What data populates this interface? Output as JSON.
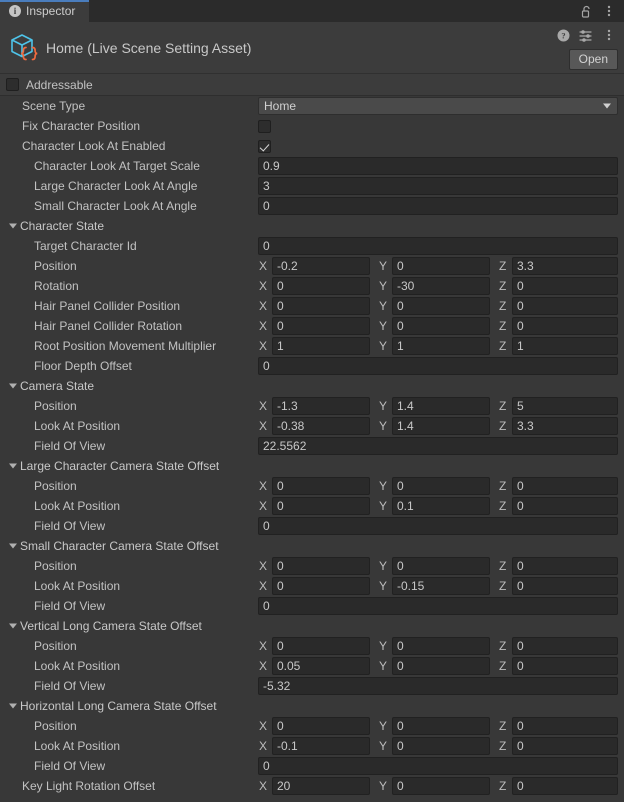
{
  "window": {
    "tab_label": "Inspector",
    "tab_icon": "info-icon",
    "lock_icon": "lock-open-icon",
    "tab_menu_icon": "kebab-menu-icon"
  },
  "asset": {
    "title": "Home (Live Scene Setting Asset)",
    "icon": "scriptable-object-cube-icon",
    "help_icon": "help-icon",
    "preset_icon": "preset-sliders-icon",
    "menu_icon": "kebab-menu-icon",
    "open_label": "Open"
  },
  "addressable": {
    "label": "Addressable",
    "checked": false
  },
  "accent": {
    "tab_underline": "#4a7dbd",
    "icon_cube": "#4ec3e8",
    "icon_braces": "#f06b3f"
  },
  "axes": {
    "x": "X",
    "y": "Y",
    "z": "Z"
  },
  "rows": [
    {
      "type": "dropdown",
      "indent": 0,
      "label": "Scene Type",
      "value": "Home"
    },
    {
      "type": "checkbox",
      "indent": 0,
      "label": "Fix Character Position",
      "checked": false
    },
    {
      "type": "checkbox",
      "indent": 0,
      "label": "Character Look At Enabled",
      "checked": true
    },
    {
      "type": "text",
      "indent": 1,
      "label": "Character Look At Target Scale",
      "value": "0.9"
    },
    {
      "type": "text",
      "indent": 1,
      "label": "Large Character Look At Angle",
      "value": "3"
    },
    {
      "type": "text",
      "indent": 1,
      "label": "Small Character Look At Angle",
      "value": "0"
    },
    {
      "type": "foldout",
      "indent": 0,
      "label": "Character State",
      "expanded": true
    },
    {
      "type": "text",
      "indent": 1,
      "label": "Target Character Id",
      "value": "0"
    },
    {
      "type": "vector3",
      "indent": 1,
      "label": "Position",
      "x": "-0.2",
      "y": "0",
      "z": "3.3"
    },
    {
      "type": "vector3",
      "indent": 1,
      "label": "Rotation",
      "x": "0",
      "y": "-30",
      "z": "0"
    },
    {
      "type": "vector3",
      "indent": 1,
      "label": "Hair Panel Collider Position",
      "x": "0",
      "y": "0",
      "z": "0"
    },
    {
      "type": "vector3",
      "indent": 1,
      "label": "Hair Panel Collider Rotation",
      "x": "0",
      "y": "0",
      "z": "0"
    },
    {
      "type": "vector3",
      "indent": 1,
      "label": "Root Position Movement Multiplier",
      "x": "1",
      "y": "1",
      "z": "1"
    },
    {
      "type": "text",
      "indent": 1,
      "label": "Floor Depth Offset",
      "value": "0"
    },
    {
      "type": "foldout",
      "indent": 0,
      "label": "Camera State",
      "expanded": true
    },
    {
      "type": "vector3",
      "indent": 1,
      "label": "Position",
      "x": "-1.3",
      "y": "1.4",
      "z": "5"
    },
    {
      "type": "vector3",
      "indent": 1,
      "label": "Look At Position",
      "x": "-0.38",
      "y": "1.4",
      "z": "3.3"
    },
    {
      "type": "text",
      "indent": 1,
      "label": "Field Of View",
      "value": "22.5562"
    },
    {
      "type": "foldout",
      "indent": 0,
      "label": "Large Character Camera State Offset",
      "expanded": true
    },
    {
      "type": "vector3",
      "indent": 1,
      "label": "Position",
      "x": "0",
      "y": "0",
      "z": "0"
    },
    {
      "type": "vector3",
      "indent": 1,
      "label": "Look At Position",
      "x": "0",
      "y": "0.1",
      "z": "0"
    },
    {
      "type": "text",
      "indent": 1,
      "label": "Field Of View",
      "value": "0"
    },
    {
      "type": "foldout",
      "indent": 0,
      "label": "Small Character Camera State Offset",
      "expanded": true
    },
    {
      "type": "vector3",
      "indent": 1,
      "label": "Position",
      "x": "0",
      "y": "0",
      "z": "0"
    },
    {
      "type": "vector3",
      "indent": 1,
      "label": "Look At Position",
      "x": "0",
      "y": "-0.15",
      "z": "0"
    },
    {
      "type": "text",
      "indent": 1,
      "label": "Field Of View",
      "value": "0"
    },
    {
      "type": "foldout",
      "indent": 0,
      "label": "Vertical Long Camera State Offset",
      "expanded": true
    },
    {
      "type": "vector3",
      "indent": 1,
      "label": "Position",
      "x": "0",
      "y": "0",
      "z": "0"
    },
    {
      "type": "vector3",
      "indent": 1,
      "label": "Look At Position",
      "x": "0.05",
      "y": "0",
      "z": "0"
    },
    {
      "type": "text",
      "indent": 1,
      "label": "Field Of View",
      "value": "-5.32"
    },
    {
      "type": "foldout",
      "indent": 0,
      "label": "Horizontal Long Camera State Offset",
      "expanded": true
    },
    {
      "type": "vector3",
      "indent": 1,
      "label": "Position",
      "x": "0",
      "y": "0",
      "z": "0"
    },
    {
      "type": "vector3",
      "indent": 1,
      "label": "Look At Position",
      "x": "-0.1",
      "y": "0",
      "z": "0"
    },
    {
      "type": "text",
      "indent": 1,
      "label": "Field Of View",
      "value": "0"
    },
    {
      "type": "vector3",
      "indent": 0,
      "label": "Key Light Rotation Offset",
      "x": "20",
      "y": "0",
      "z": "0"
    }
  ]
}
